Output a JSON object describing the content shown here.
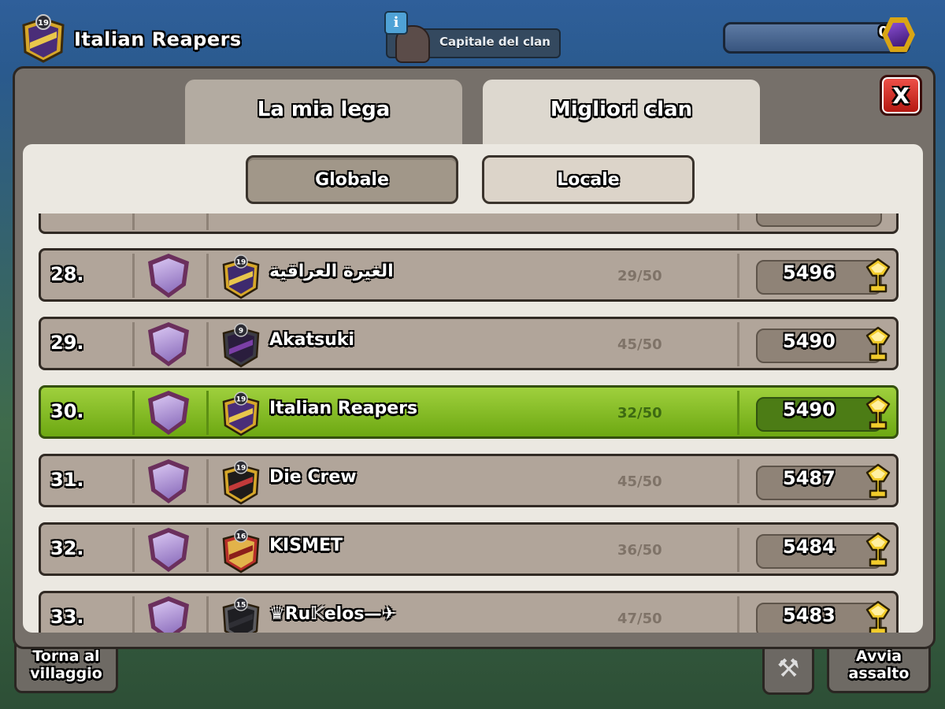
{
  "hud": {
    "clan_level": "19",
    "clan_name": "Italian Reapers",
    "info_label": "i",
    "capital_label": "Capitale del clan",
    "resource_value": "0",
    "back_button": "Torna al villaggio",
    "attack_button": "Avvia assalto"
  },
  "dialog": {
    "tabs": [
      "La mia lega",
      "Migliori clan"
    ],
    "active_tab": "Migliori clan",
    "close_label": "X",
    "subtabs": [
      "Globale",
      "Locale"
    ],
    "active_subtab": "Globale"
  },
  "rows": [
    {
      "rank": "28.",
      "badge_level": "19",
      "name": "الغيرة العراقية",
      "members": "29/50",
      "trophies": "5496",
      "badge": "gold-stripe"
    },
    {
      "rank": "29.",
      "badge_level": "9",
      "name": "Akatsuki",
      "members": "45/50",
      "trophies": "5490",
      "badge": "dark-purple"
    },
    {
      "rank": "30.",
      "badge_level": "19",
      "name": "Italian Reapers",
      "members": "32/50",
      "trophies": "5490",
      "badge": "gold-purple",
      "highlight": true
    },
    {
      "rank": "31.",
      "badge_level": "19",
      "name": "Die Crew",
      "members": "45/50",
      "trophies": "5487",
      "badge": "gold-black"
    },
    {
      "rank": "32.",
      "badge_level": "16",
      "name": "KISMET",
      "members": "36/50",
      "trophies": "5484",
      "badge": "red-gold"
    },
    {
      "rank": "33.",
      "badge_level": "15",
      "name": "♛Ru𝕂elos—✈",
      "members": "47/50",
      "trophies": "5483",
      "badge": "grey-black"
    }
  ],
  "colors": {
    "highlight_row": "#8cc227",
    "row": "#b1a59a",
    "tab_active": "#ddd8cf",
    "tab_inactive": "#b3aba1",
    "close_button": "#d9302a"
  }
}
